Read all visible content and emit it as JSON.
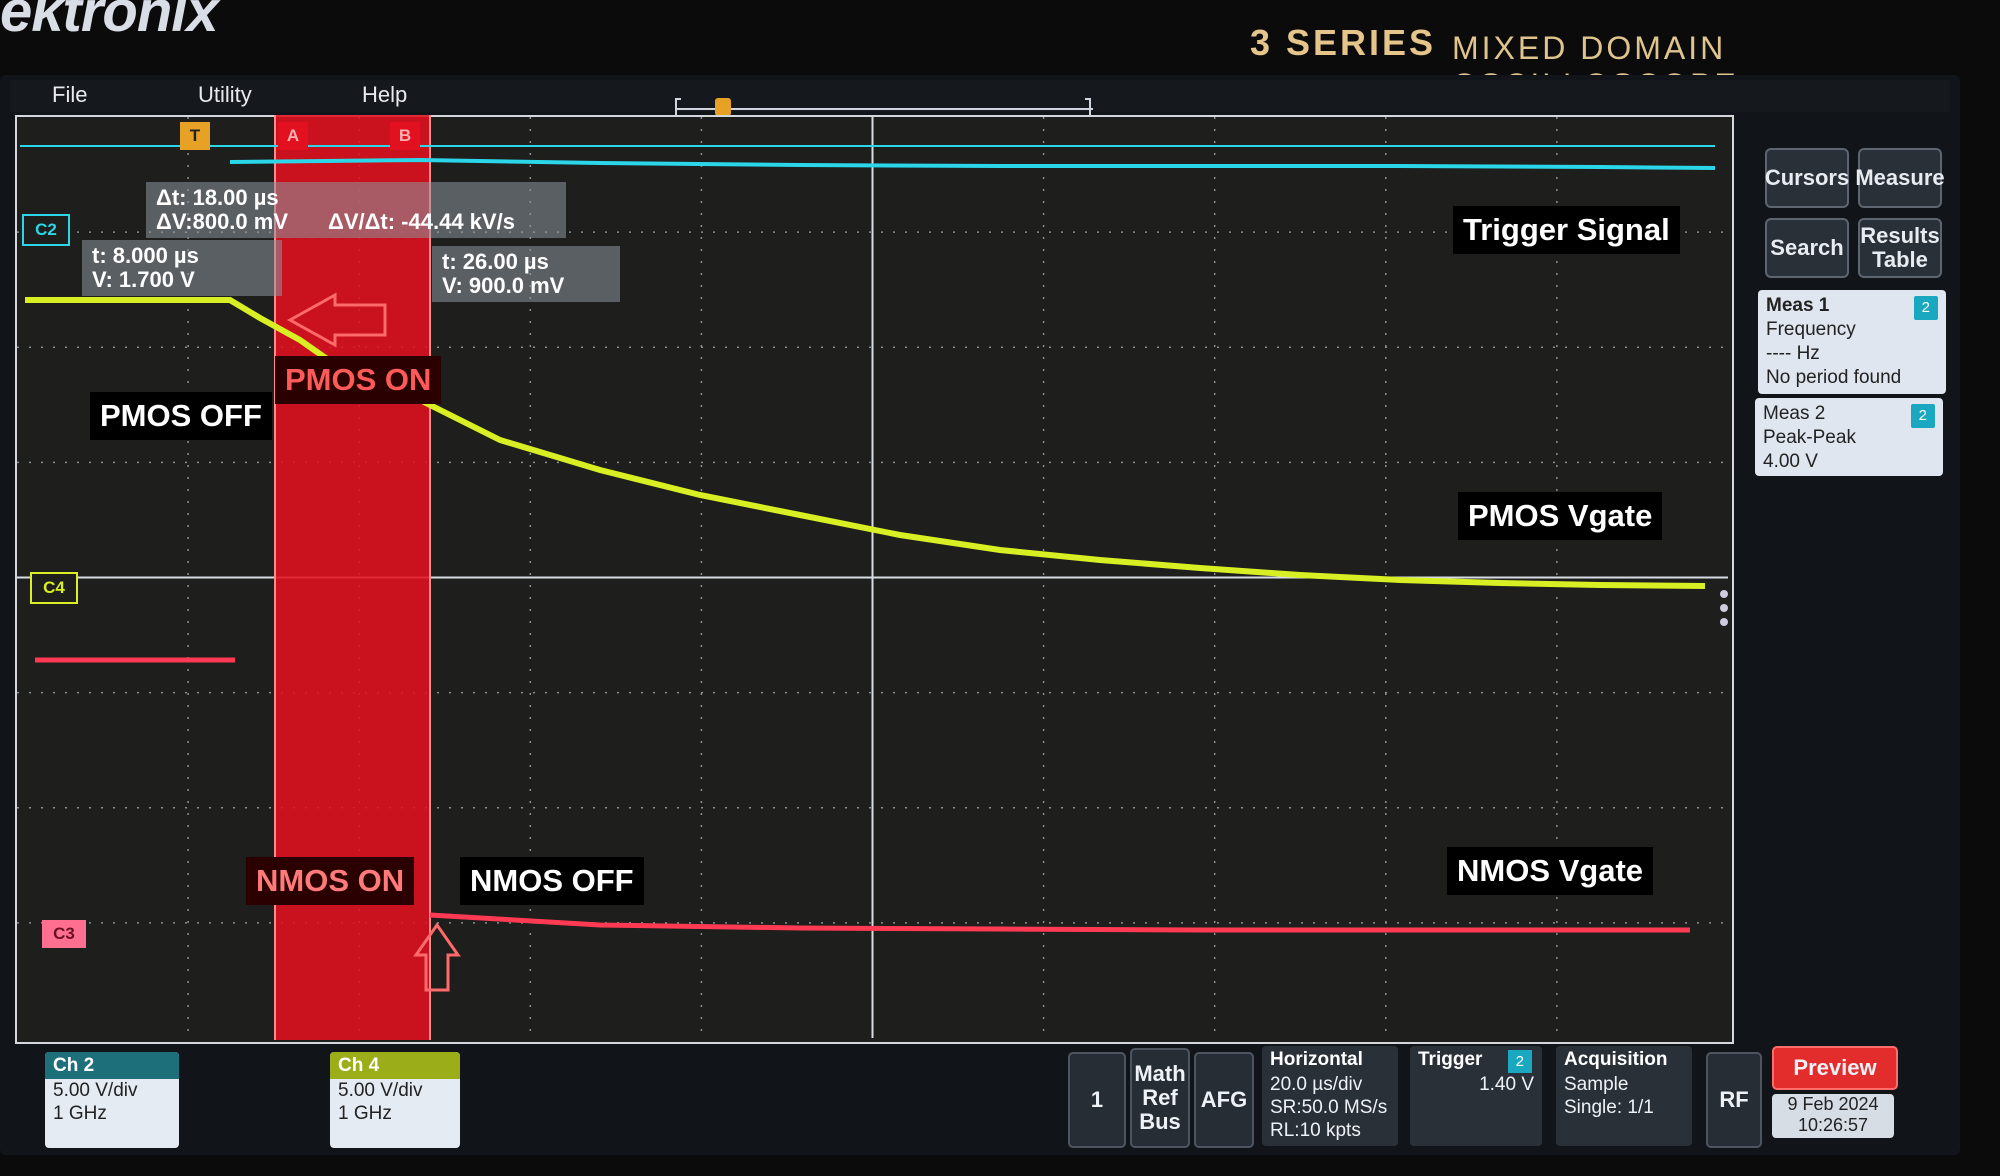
{
  "header": {
    "brand": "ektronix",
    "series": "3 SERIES",
    "subtitle": "MIXED DOMAIN OSCILLOSCOPE"
  },
  "menu": {
    "file": "File",
    "utility": "Utility",
    "help": "Help"
  },
  "cursors": {
    "a": "A",
    "b": "B"
  },
  "readouts": {
    "delta_t": "Δt: 18.00 µs",
    "delta_v": "ΔV:800.0 mV",
    "dvdt": "ΔV/Δt: -44.44 kV/s",
    "cursor_a_t": "t:   8.000 µs",
    "cursor_a_v": "V:   1.700 V",
    "cursor_b_t": "t:   26.00 µs",
    "cursor_b_v": "V:   900.0 mV"
  },
  "annotations": {
    "trigger_signal": "Trigger Signal",
    "pmos_off": "PMOS OFF",
    "pmos_on": "PMOS ON",
    "pmos_vgate": "PMOS Vgate",
    "nmos_on": "NMOS ON",
    "nmos_off": "NMOS OFF",
    "nmos_vgate": "NMOS Vgate"
  },
  "channel_markers": {
    "c2": "C2",
    "c4": "C4",
    "c3": "C3",
    "trigger": "T"
  },
  "side_panel": {
    "cursors": "Cursors",
    "measure": "Measure",
    "search": "Search",
    "results_table_line1": "Results",
    "results_table_line2": "Table",
    "meas1": {
      "title": "Meas 1",
      "channel": "2",
      "line1": "Frequency",
      "line2": "---- Hz",
      "line3": "No period found"
    },
    "meas2": {
      "title": "Meas 2",
      "channel": "2",
      "line1": "Peak-Peak",
      "line2": "4.00 V"
    }
  },
  "bottom_bar": {
    "ch2": {
      "title": "Ch 2",
      "scale": "5.00 V/div",
      "bw": "1 GHz"
    },
    "ch4": {
      "title": "Ch 4",
      "scale": "5.00 V/div",
      "bw": "1 GHz"
    },
    "ch1_btn": "1",
    "math_ref_bus": [
      "Math",
      "Ref",
      "Bus"
    ],
    "afg": "AFG",
    "horizontal": {
      "title": "Horizontal",
      "scale": "20.0 µs/div",
      "sr": "SR:50.0 MS/s",
      "rl": "RL:10 kpts"
    },
    "trigger": {
      "title": "Trigger",
      "channel": "2",
      "level": "1.40 V"
    },
    "acquisition": {
      "title": "Acquisition",
      "mode": "Sample",
      "single": "Single: 1/1"
    },
    "rf": "RF",
    "preview": "Preview",
    "date": "9 Feb 2024",
    "time": "10:26:57"
  },
  "colors": {
    "ch2": "#2ad6e8",
    "ch4": "#d8ef24",
    "ch3": "#ff3a52",
    "cursor_band": "#e3111f",
    "preview": "#e32c2c"
  }
}
